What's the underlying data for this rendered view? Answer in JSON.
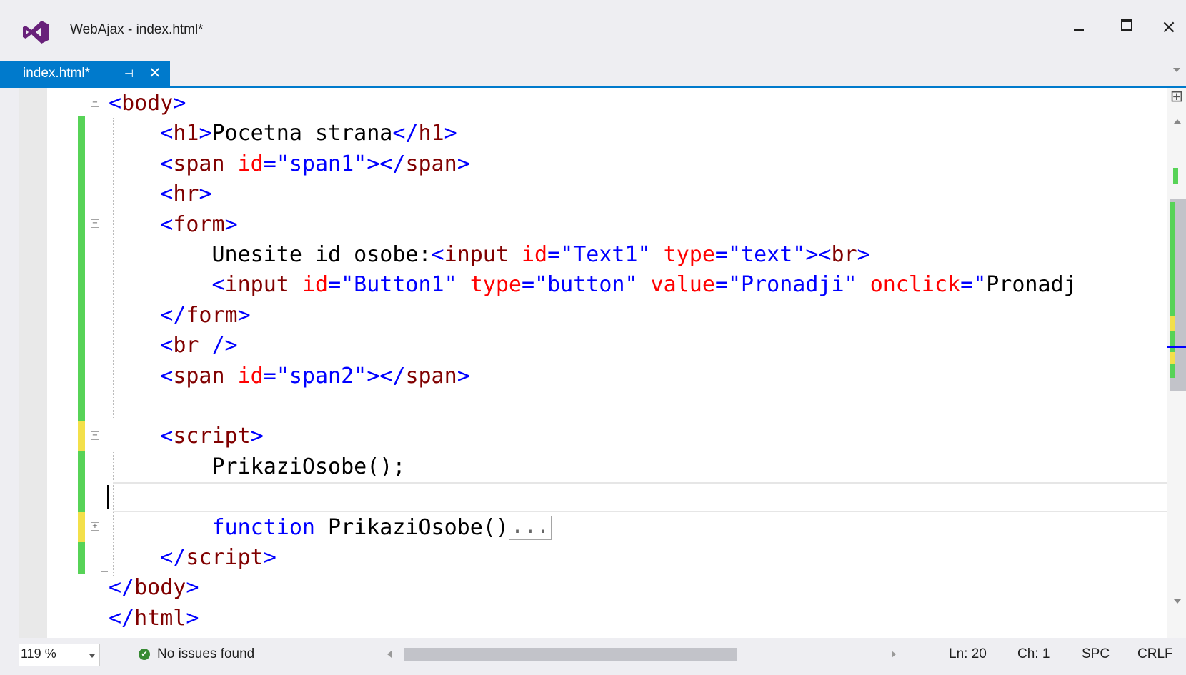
{
  "window": {
    "title": "WebAjax - index.html*",
    "controls": {
      "minimize": "minimize-icon",
      "maximize": "maximize-icon",
      "close": "×"
    }
  },
  "tab": {
    "label": "index.html*",
    "pin": "⊣",
    "close": "✕"
  },
  "editor": {
    "lines": [
      {
        "indent": "",
        "tokens": [
          [
            "t",
            "<"
          ],
          [
            "tn",
            "body"
          ],
          [
            "t",
            ">"
          ]
        ]
      },
      {
        "indent": "    ",
        "tokens": [
          [
            "t",
            "<"
          ],
          [
            "tn",
            "h1"
          ],
          [
            "t",
            ">"
          ],
          [
            "x",
            "Pocetna strana"
          ],
          [
            "t",
            "</"
          ],
          [
            "tn",
            "h1"
          ],
          [
            "t",
            ">"
          ]
        ]
      },
      {
        "indent": "    ",
        "tokens": [
          [
            "t",
            "<"
          ],
          [
            "tn",
            "span"
          ],
          [
            "x",
            " "
          ],
          [
            "an",
            "id"
          ],
          [
            "t",
            "="
          ],
          [
            "av",
            "\"span1\""
          ],
          [
            "t",
            "></"
          ],
          [
            "tn",
            "span"
          ],
          [
            "t",
            ">"
          ]
        ]
      },
      {
        "indent": "    ",
        "tokens": [
          [
            "t",
            "<"
          ],
          [
            "tn",
            "hr"
          ],
          [
            "t",
            ">"
          ]
        ]
      },
      {
        "indent": "    ",
        "tokens": [
          [
            "t",
            "<"
          ],
          [
            "tn",
            "form"
          ],
          [
            "t",
            ">"
          ]
        ]
      },
      {
        "indent": "        ",
        "tokens": [
          [
            "x",
            "Unesite id osobe:"
          ],
          [
            "t",
            "<"
          ],
          [
            "tn",
            "input"
          ],
          [
            "x",
            " "
          ],
          [
            "an",
            "id"
          ],
          [
            "t",
            "="
          ],
          [
            "av",
            "\"Text1\""
          ],
          [
            "x",
            " "
          ],
          [
            "an",
            "type"
          ],
          [
            "t",
            "="
          ],
          [
            "av",
            "\"text\""
          ],
          [
            "t",
            "><"
          ],
          [
            "tn",
            "br"
          ],
          [
            "t",
            ">"
          ]
        ]
      },
      {
        "indent": "        ",
        "tokens": [
          [
            "t",
            "<"
          ],
          [
            "tn",
            "input"
          ],
          [
            "x",
            " "
          ],
          [
            "an",
            "id"
          ],
          [
            "t",
            "="
          ],
          [
            "av",
            "\"Button1\""
          ],
          [
            "x",
            " "
          ],
          [
            "an",
            "type"
          ],
          [
            "t",
            "="
          ],
          [
            "av",
            "\"button\""
          ],
          [
            "x",
            " "
          ],
          [
            "an",
            "value"
          ],
          [
            "t",
            "="
          ],
          [
            "av",
            "\"Pronadji\""
          ],
          [
            "x",
            " "
          ],
          [
            "an",
            "onclick"
          ],
          [
            "t",
            "="
          ],
          [
            "av",
            "\""
          ],
          [
            "x",
            "Pronadj"
          ]
        ]
      },
      {
        "indent": "    ",
        "tokens": [
          [
            "t",
            "</"
          ],
          [
            "tn",
            "form"
          ],
          [
            "t",
            ">"
          ]
        ]
      },
      {
        "indent": "    ",
        "tokens": [
          [
            "t",
            "<"
          ],
          [
            "tn",
            "br"
          ],
          [
            "x",
            " "
          ],
          [
            "t",
            "/>"
          ]
        ]
      },
      {
        "indent": "    ",
        "tokens": [
          [
            "t",
            "<"
          ],
          [
            "tn",
            "span"
          ],
          [
            "x",
            " "
          ],
          [
            "an",
            "id"
          ],
          [
            "t",
            "="
          ],
          [
            "av",
            "\"span2\""
          ],
          [
            "t",
            "></"
          ],
          [
            "tn",
            "span"
          ],
          [
            "t",
            ">"
          ]
        ]
      },
      {
        "indent": "",
        "tokens": []
      },
      {
        "indent": "    ",
        "tokens": [
          [
            "t",
            "<"
          ],
          [
            "tn",
            "script"
          ],
          [
            "t",
            ">"
          ]
        ]
      },
      {
        "indent": "        ",
        "tokens": [
          [
            "x",
            "PrikaziOsobe();"
          ]
        ]
      },
      {
        "indent": "",
        "tokens": []
      },
      {
        "indent": "        ",
        "tokens": [
          [
            "kw",
            "function"
          ],
          [
            "x",
            " PrikaziOsobe()"
          ],
          [
            "box",
            "..."
          ]
        ]
      },
      {
        "indent": "    ",
        "tokens": [
          [
            "t",
            "</"
          ],
          [
            "tn",
            "script"
          ],
          [
            "t",
            ">"
          ]
        ]
      },
      {
        "indent": "",
        "tokens": [
          [
            "t",
            "</"
          ],
          [
            "tn",
            "body"
          ],
          [
            "t",
            ">"
          ]
        ]
      },
      {
        "indent": "",
        "tokens": [
          [
            "t",
            "</"
          ],
          [
            "tn",
            "html"
          ],
          [
            "t",
            ">"
          ]
        ]
      }
    ]
  },
  "statusbar": {
    "zoom": "119 %",
    "issues": "No issues found",
    "line": "Ln: 20",
    "col": "Ch: 1",
    "spacing": "SPC",
    "eol": "CRLF"
  },
  "colors": {
    "accent": "#007acc",
    "saved_change": "#57d357",
    "unsaved_change": "#f3e04a",
    "tag_delimiter": "#0000ff",
    "tag_name": "#800000",
    "attr_name": "#ff0000",
    "attr_value": "#0000ff"
  }
}
